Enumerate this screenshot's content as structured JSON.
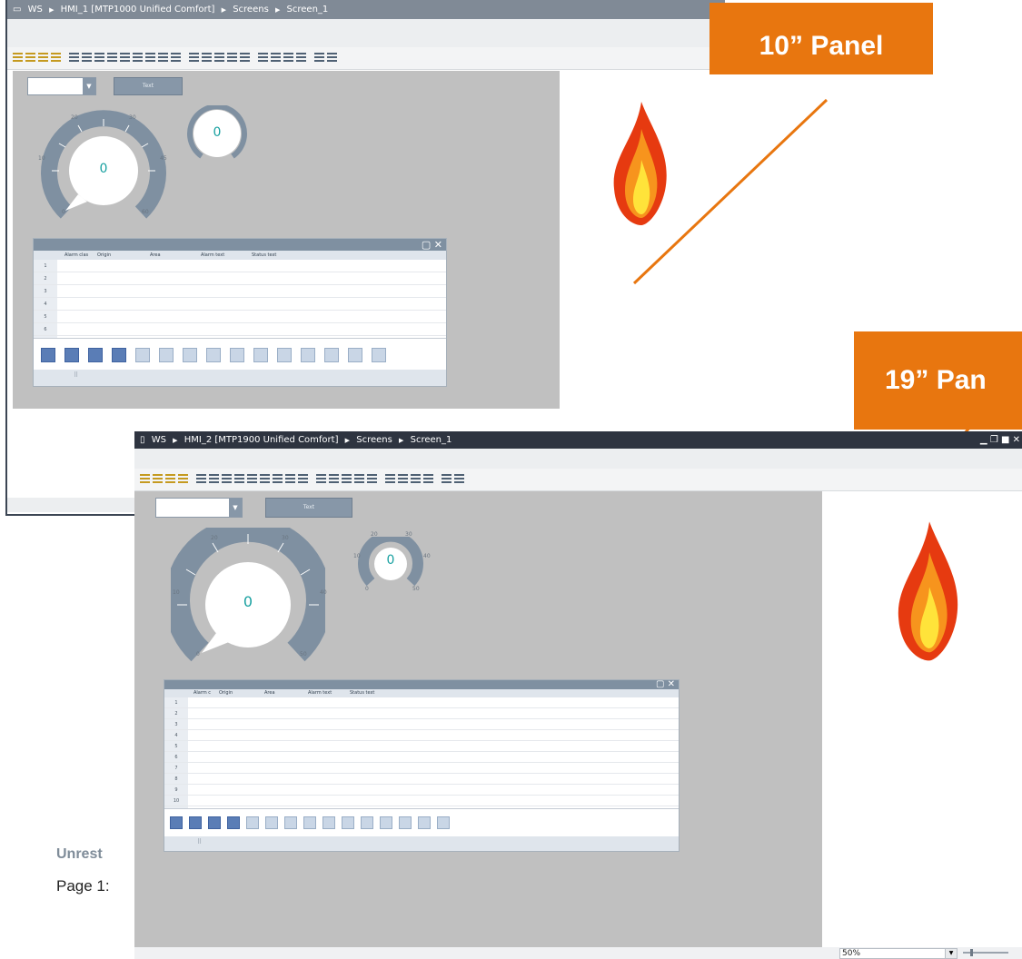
{
  "window1": {
    "title": {
      "icon": "window-icon",
      "parts": [
        "WS",
        "HMI_1 [MTP1000 Unified Comfort]",
        "Screens",
        "Screen_1"
      ]
    },
    "button_text": "Text",
    "gauge_large": {
      "value": "0",
      "ticks": [
        "0",
        "10",
        "20",
        "30",
        "45",
        "60"
      ]
    },
    "gauge_small": {
      "value": "0"
    },
    "alarm": {
      "columns": [
        "Alarm clas",
        "Origin",
        "Area",
        "Alarm text",
        "Status text"
      ],
      "rows": [
        "1",
        "2",
        "3",
        "4",
        "5",
        "6"
      ]
    }
  },
  "window2": {
    "title": {
      "icon": "window-icon",
      "parts": [
        "WS",
        "HMI_2 [MTP1900 Unified Comfort]",
        "Screens",
        "Screen_1"
      ]
    },
    "button_text": "Text",
    "gauge_large": {
      "value": "0",
      "ticks": [
        "0",
        "10",
        "20",
        "30",
        "40",
        "50"
      ]
    },
    "gauge_small": {
      "value": "0",
      "ticks": [
        "0",
        "10",
        "20",
        "30",
        "40",
        "50"
      ]
    },
    "alarm": {
      "columns": [
        "Alarm c",
        "Origin",
        "Area",
        "Alarm text",
        "Status text"
      ],
      "rows": [
        "1",
        "2",
        "3",
        "4",
        "5",
        "6",
        "7",
        "8",
        "9",
        "10"
      ]
    },
    "zoom": "50%"
  },
  "callouts": {
    "panel10": "10” Panel",
    "panel19": "19” Pan"
  },
  "page": {
    "classification": "Unrest",
    "page_label": "Page 1:"
  },
  "colors": {
    "orange": "#e8760f",
    "canvas": "#c0c0c0",
    "gauge": "#7f90a1",
    "teal": "#18a0a0"
  }
}
